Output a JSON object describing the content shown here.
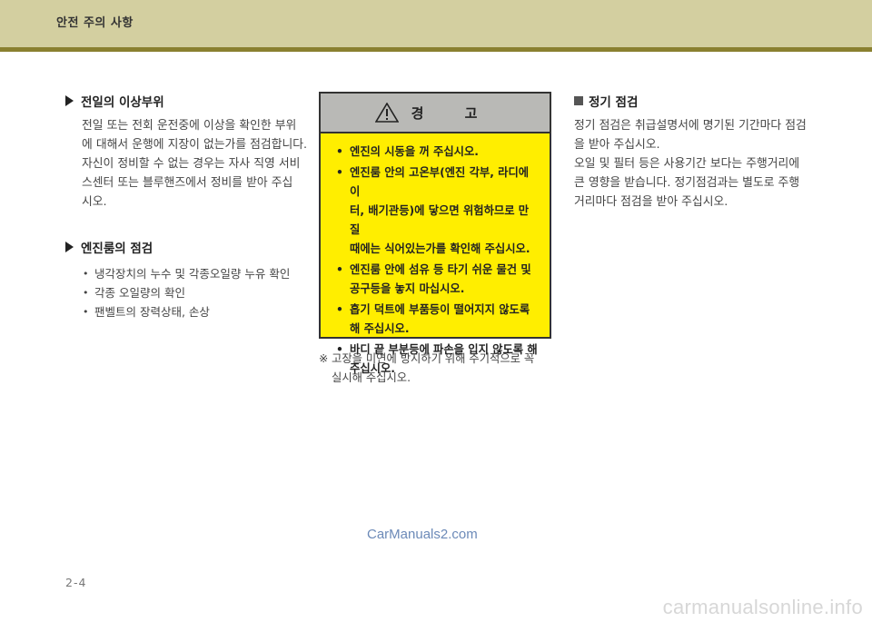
{
  "header": {
    "title": "안전 주의 사항"
  },
  "col1": {
    "section1": {
      "heading": "전일의 이상부위",
      "lines": [
        "전일 또는 전회 운전중에 이상을 확인한 부위",
        "에 대해서 운행에 지장이 없는가를 점검합니다.",
        "자신이 정비할 수 없는 경우는 자사 직영 서비",
        "스센터 또는 블루핸즈에서 정비를 받아 주십",
        "시오."
      ]
    },
    "section2": {
      "heading": "엔진룸의 점검",
      "items": [
        "냉각장치의 누수 및 각종오일량 누유 확인",
        "각종 오일량의 확인",
        "팬벨트의 장력상태, 손상"
      ]
    }
  },
  "warning": {
    "title": "경 고",
    "icon": "warning-triangle-icon",
    "items": [
      [
        "엔진의 시동을 꺼 주십시오."
      ],
      [
        "엔진룸 안의 고온부(엔진 각부, 라디에이",
        "터, 배기관등)에 닿으면 위험하므로 만질",
        "때에는 식어있는가를 확인해 주십시오."
      ],
      [
        "엔진룸 안에 섬유 등 타기 쉬운 물건 및",
        "공구등을 놓지 마십시오."
      ],
      [
        "흡기 덕트에 부품등이 떨어지지 않도록",
        "해 주십시오."
      ],
      [
        "바디 끝 부분등에 파손을 입지 않도록 해",
        "주십시오."
      ]
    ]
  },
  "note": {
    "mark": "※",
    "lines": [
      "고장을 미연에 방지하기 위해 주기적으로 꼭",
      "실시해 주십시오."
    ]
  },
  "col3": {
    "heading": "정기 점검",
    "lines": [
      "정기 점검은 취급설명서에 명기된 기간마다 점검",
      "을 받아 주십시오.",
      "오일 및 필터 등은 사용기간 보다는 주행거리에",
      "큰 영향을 받습니다. 정기점검과는 별도로 주행",
      "거리마다 점검을 받아 주십시오."
    ]
  },
  "watermark": "CarManuals2.com",
  "page_number": "2-4",
  "footer_watermark": "carmanualsonline.info",
  "colors": {
    "header_bg": "#d3cfa0",
    "header_line": "#8a8030",
    "warning_bg": "#ffee00",
    "warning_head_bg": "#b9b9b6"
  }
}
